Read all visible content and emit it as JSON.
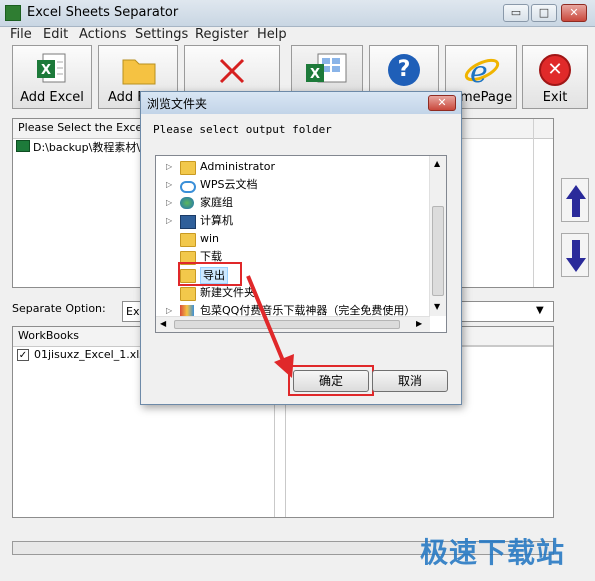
{
  "window": {
    "title": "Excel Sheets Separator",
    "buttons": {
      "minimize": "▭",
      "maximize": "□",
      "close": "✕"
    }
  },
  "menu": [
    "File",
    "Edit",
    "Actions",
    "Settings",
    "Register",
    "Help"
  ],
  "toolbar": {
    "add_excel": "Add Excel",
    "add_folder": "Add F",
    "homepage": "mePage",
    "exit": "Exit"
  },
  "left_panel": {
    "header": "Please Select the Excel F",
    "item": "D:\\backup\\教程素材\\E"
  },
  "separate_option": {
    "label": "Separate Option:",
    "value": "Ex"
  },
  "workbooks": {
    "header": "WorkBooks",
    "item": "01jisuxz_Excel_1.xls"
  },
  "dialog": {
    "title": "浏览文件夹",
    "prompt": "Please select output folder",
    "tree": [
      {
        "label": "Administrator",
        "expandable": true,
        "icon": "user-folder"
      },
      {
        "label": "WPS云文档",
        "expandable": true,
        "icon": "cloud"
      },
      {
        "label": "家庭组",
        "expandable": true,
        "icon": "homegroup"
      },
      {
        "label": "计算机",
        "expandable": true,
        "icon": "computer"
      },
      {
        "label": "win",
        "expandable": false,
        "icon": "folder"
      },
      {
        "label": "下载",
        "expandable": false,
        "icon": "folder"
      },
      {
        "label": "导出",
        "expandable": false,
        "icon": "folder"
      },
      {
        "label": "新建文件夹",
        "expandable": false,
        "icon": "folder"
      },
      {
        "label": "包菜QQ付费音乐下载神器（完全免费使用）",
        "expandable": true,
        "icon": "archive"
      }
    ],
    "ok": "确定",
    "cancel": "取消"
  },
  "watermark": "极速下载站",
  "colors": {
    "accent_red": "#e0282a",
    "arrow_blue": "#2a2a9a"
  }
}
